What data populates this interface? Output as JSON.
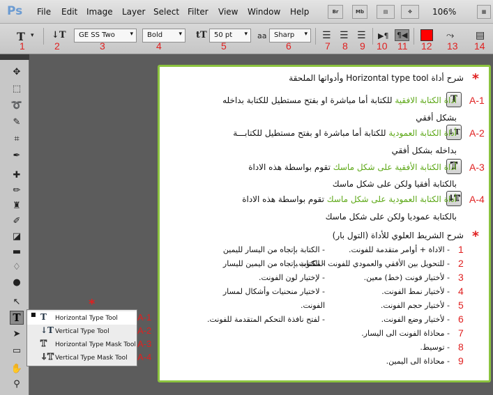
{
  "app_logo": "Ps",
  "menu": [
    "File",
    "Edit",
    "Image",
    "Layer",
    "Select",
    "Filter",
    "View",
    "Window",
    "Help"
  ],
  "menubar_buttons": [
    "Br",
    "Mb"
  ],
  "zoom": "106%",
  "options_bar": {
    "font_family": "GE SS Two",
    "font_style": "Bold",
    "font_size": "50 pt",
    "anti_alias_label": "aa",
    "anti_alias": "Sharp",
    "text_color": "#ff0000",
    "numbers": [
      "1",
      "2",
      "3",
      "4",
      "5",
      "6",
      "7",
      "8",
      "9",
      "10",
      "11",
      "12",
      "13",
      "14"
    ]
  },
  "flyout": {
    "star": "*",
    "items": [
      {
        "label": "Horizontal Type Tool",
        "code": "A-1",
        "icon": "T"
      },
      {
        "label": "Vertical Type Tool",
        "code": "A-2",
        "icon": "↓T"
      },
      {
        "label": "Horizontal Type Mask Tool",
        "code": "A-3",
        "icon": "T"
      },
      {
        "label": "Vertical Type Mask Tool",
        "code": "A-4",
        "icon": "↓T"
      }
    ]
  },
  "panel": {
    "heading": "شرح أداة Horizontal type tool وأدواتها الملحقة",
    "tools": [
      {
        "code": "A-1",
        "icon": "T",
        "name": "أداة الكتابة الافقية",
        "desc": " للكتابة أما مباشرة او بفتح مستطيل للكتابة بداخله",
        "line2": "بشكل أفقي"
      },
      {
        "code": "A-2",
        "icon": "↓T",
        "name": "أداة الكتابة العمودية",
        "desc": " للكتابة أما مباشرة او بفتح مستطيل للكتابـــة",
        "line2": "بداخله بشكل أفقي"
      },
      {
        "code": "A-3",
        "icon": "T",
        "name": "أداة الكتابة الأفقية على شكل ماسك",
        "desc": " تقوم بواسطة هذه الاداة",
        "line2": "بالكتابة أفقيا ولكن على شكل ماسك"
      },
      {
        "code": "A-4",
        "icon": "↓T",
        "name": "أداة الكتابة العمودية على شكل ماسك",
        "desc": " تقوم بواسطة هذه الاداة",
        "line2": "بالكتابة عموديا ولكن على شكل ماسك"
      }
    ],
    "toolbar_heading": "شرح الشريط العلوي للأداة (التول بار)",
    "right_list": [
      {
        "n": "1",
        "text": "- الاداة + أوامر متقدمة للفونت."
      },
      {
        "n": "2",
        "text": "- للتحويل بين الأفقي والعمودي للفونت المكتوب."
      },
      {
        "n": "3",
        "text": "- لأختيار فونت (خط) معين."
      },
      {
        "n": "4",
        "text": "- لأختيار نمط الفونت."
      },
      {
        "n": "5",
        "text": "- لأختيار حجم الفونت."
      },
      {
        "n": "6",
        "text": "- لأختيار وضع الفونت."
      },
      {
        "n": "7",
        "text": "- محاذاة الفونت الى اليسار."
      },
      {
        "n": "8",
        "text": "- توسيط."
      },
      {
        "n": "9",
        "text": "- محاذاة الى اليمين."
      }
    ],
    "left_list": [
      "- الكتابة بإتجاه من اليسار لليمين",
      "- الكتابة بإتجاه من اليمين لليسار",
      "- لإختيار لون الفونت.",
      "- لاختيار منحنيات وأشكال لمسار",
      "الفونت.",
      "- لفتح نافذة التحكم المتقدمة للفونت."
    ]
  }
}
